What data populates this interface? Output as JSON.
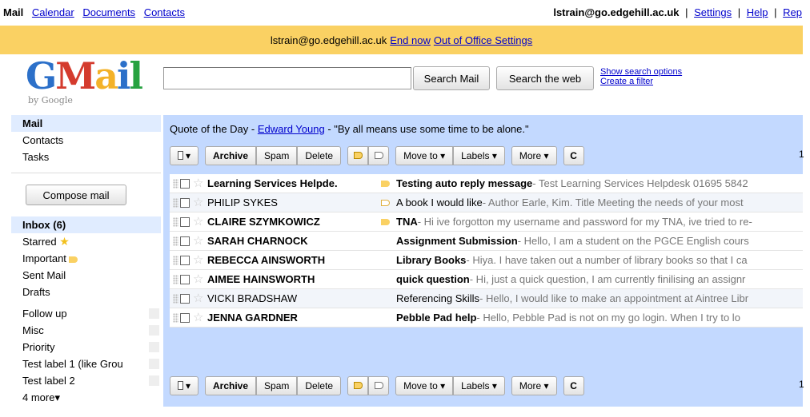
{
  "topbar": {
    "apps": [
      "Mail",
      "Calendar",
      "Documents",
      "Contacts"
    ],
    "email": "lstrain@go.edgehill.ac.uk",
    "settings": "Settings",
    "help": "Help",
    "extra": "Rep",
    "sep": "|"
  },
  "ooo": {
    "email": "lstrain@go.edgehill.ac.uk",
    "end_now": "End now",
    "settings": "Out of Office Settings"
  },
  "logo": {
    "text_g": "G",
    "text_m": "M",
    "text_a": "a",
    "text_i": "i",
    "text_l": "l",
    "byline": "by Google"
  },
  "search": {
    "value": "",
    "search_mail": "Search Mail",
    "search_web": "Search the web",
    "show_options": "Show search options",
    "create_filter": "Create a filter"
  },
  "nav": {
    "mail": "Mail",
    "contacts": "Contacts",
    "tasks": "Tasks",
    "compose": "Compose mail",
    "inbox": "Inbox (6)",
    "starred": "Starred",
    "important": "Important",
    "sent": "Sent Mail",
    "drafts": "Drafts",
    "labels": [
      "Follow up",
      "Misc",
      "Priority",
      "Test label 1 (like Grou",
      "Test label 2"
    ],
    "more": "4 more▾"
  },
  "quote": {
    "prefix": "Quote of the Day - ",
    "author": "Edward Young",
    "text": " - \"By all means use some time to be alone.\""
  },
  "toolbar": {
    "select_arrow": "▾",
    "archive": "Archive",
    "spam": "Spam",
    "delete": "Delete",
    "move_to": "Move to ▾",
    "labels": "Labels ▾",
    "more": "More ▾",
    "refresh": "C",
    "count": "1"
  },
  "emails": [
    {
      "from": "Learning Services Helpde.",
      "subject": "Testing auto reply message",
      "snippet": " - Test Learning Services Helpdesk 01695 5842",
      "unread": true,
      "important": "on"
    },
    {
      "from": "PHILIP SYKES",
      "subject": "A book I would like",
      "snippet": " - Author Earle, Kim. Title Meeting the needs of your most",
      "unread": false,
      "important": "off"
    },
    {
      "from": "CLAIRE SZYMKOWICZ",
      "subject": "TNA",
      "snippet": " - Hi ive forgotton my username and password for my TNA, ive tried to re-",
      "unread": true,
      "important": "on"
    },
    {
      "from": "SARAH CHARNOCK",
      "subject": "Assignment Submission",
      "snippet": " - Hello, I am a student on the PGCE English cours",
      "unread": true,
      "important": "none"
    },
    {
      "from": "REBECCA AINSWORTH",
      "subject": "Library Books",
      "snippet": " - Hiya. I have taken out a number of library books so that I ca",
      "unread": true,
      "important": "none"
    },
    {
      "from": "AIMEE HAINSWORTH",
      "subject": "quick question",
      "snippet": " - Hi, just a quick question, I am currently finilising an assignr",
      "unread": true,
      "important": "none"
    },
    {
      "from": "VICKI BRADSHAW",
      "subject": "Referencing Skills",
      "snippet": " - Hello, I would like to make an appointment at Aintree Libr",
      "unread": false,
      "important": "none"
    },
    {
      "from": "JENNA GARDNER",
      "subject": "Pebble Pad help",
      "snippet": " - Hello, Pebble Pad is not on my go login. When I try to lo",
      "unread": true,
      "important": "none"
    }
  ],
  "colors": {
    "accent_bg": "#c3d9ff",
    "ooo_bg": "#fad163",
    "link": "#0000cc"
  }
}
